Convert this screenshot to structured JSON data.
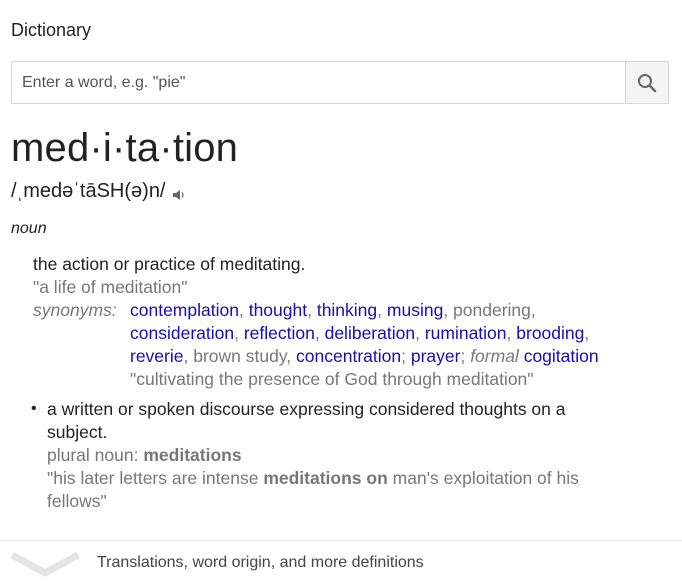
{
  "section_title": "Dictionary",
  "search": {
    "placeholder": "Enter a word, e.g. \"pie\"",
    "value": ""
  },
  "entry": {
    "headword": "med·i·ta·tion",
    "phonetic": "/ˌmedəˈtāSH(ə)n/",
    "part_of_speech": "noun",
    "sense1": {
      "definition": "the action or practice of meditating.",
      "example": "\"a life of meditation\"",
      "synonyms_label": "synonyms:",
      "synonyms": [
        {
          "text": "contemplation",
          "link": true
        },
        {
          "text": "thought",
          "link": true
        },
        {
          "text": "thinking",
          "link": true
        },
        {
          "text": "musing",
          "link": true
        },
        {
          "text": "pondering",
          "link": false
        },
        {
          "text": "consideration",
          "link": true
        },
        {
          "text": "reflection",
          "link": true
        },
        {
          "text": "deliberation",
          "link": true
        },
        {
          "text": "rumination",
          "link": true
        },
        {
          "text": "brooding",
          "link": true
        },
        {
          "text": "reverie",
          "link": true
        },
        {
          "text": "brown study",
          "link": false
        },
        {
          "text": "concentration",
          "link": true
        },
        {
          "text": "prayer",
          "link": true
        },
        {
          "text": "formal",
          "link": false
        },
        {
          "text": "cogitation",
          "link": true
        }
      ],
      "synonym_example": "\"cultivating the presence of God through meditation\""
    },
    "sense2": {
      "bullet": "•",
      "definition_line1": "a written or spoken discourse expressing considered thoughts on a",
      "definition_line2": "subject.",
      "plural_label": "plural noun:",
      "plural_word": "meditations",
      "example_prefix": "\"his later letters are intense",
      "example_bold": "meditations on",
      "example_suffix_line1": "man's exploitation of his",
      "example_suffix_line2": "fellows\""
    }
  },
  "more_link": "Translations, word origin, and more definitions",
  "icons": {
    "search": "search-icon",
    "speaker": "speaker-icon",
    "expand": "chevron-down-icon"
  },
  "colors": {
    "link": "#1a0dab",
    "muted": "#777777",
    "text": "#222222"
  }
}
